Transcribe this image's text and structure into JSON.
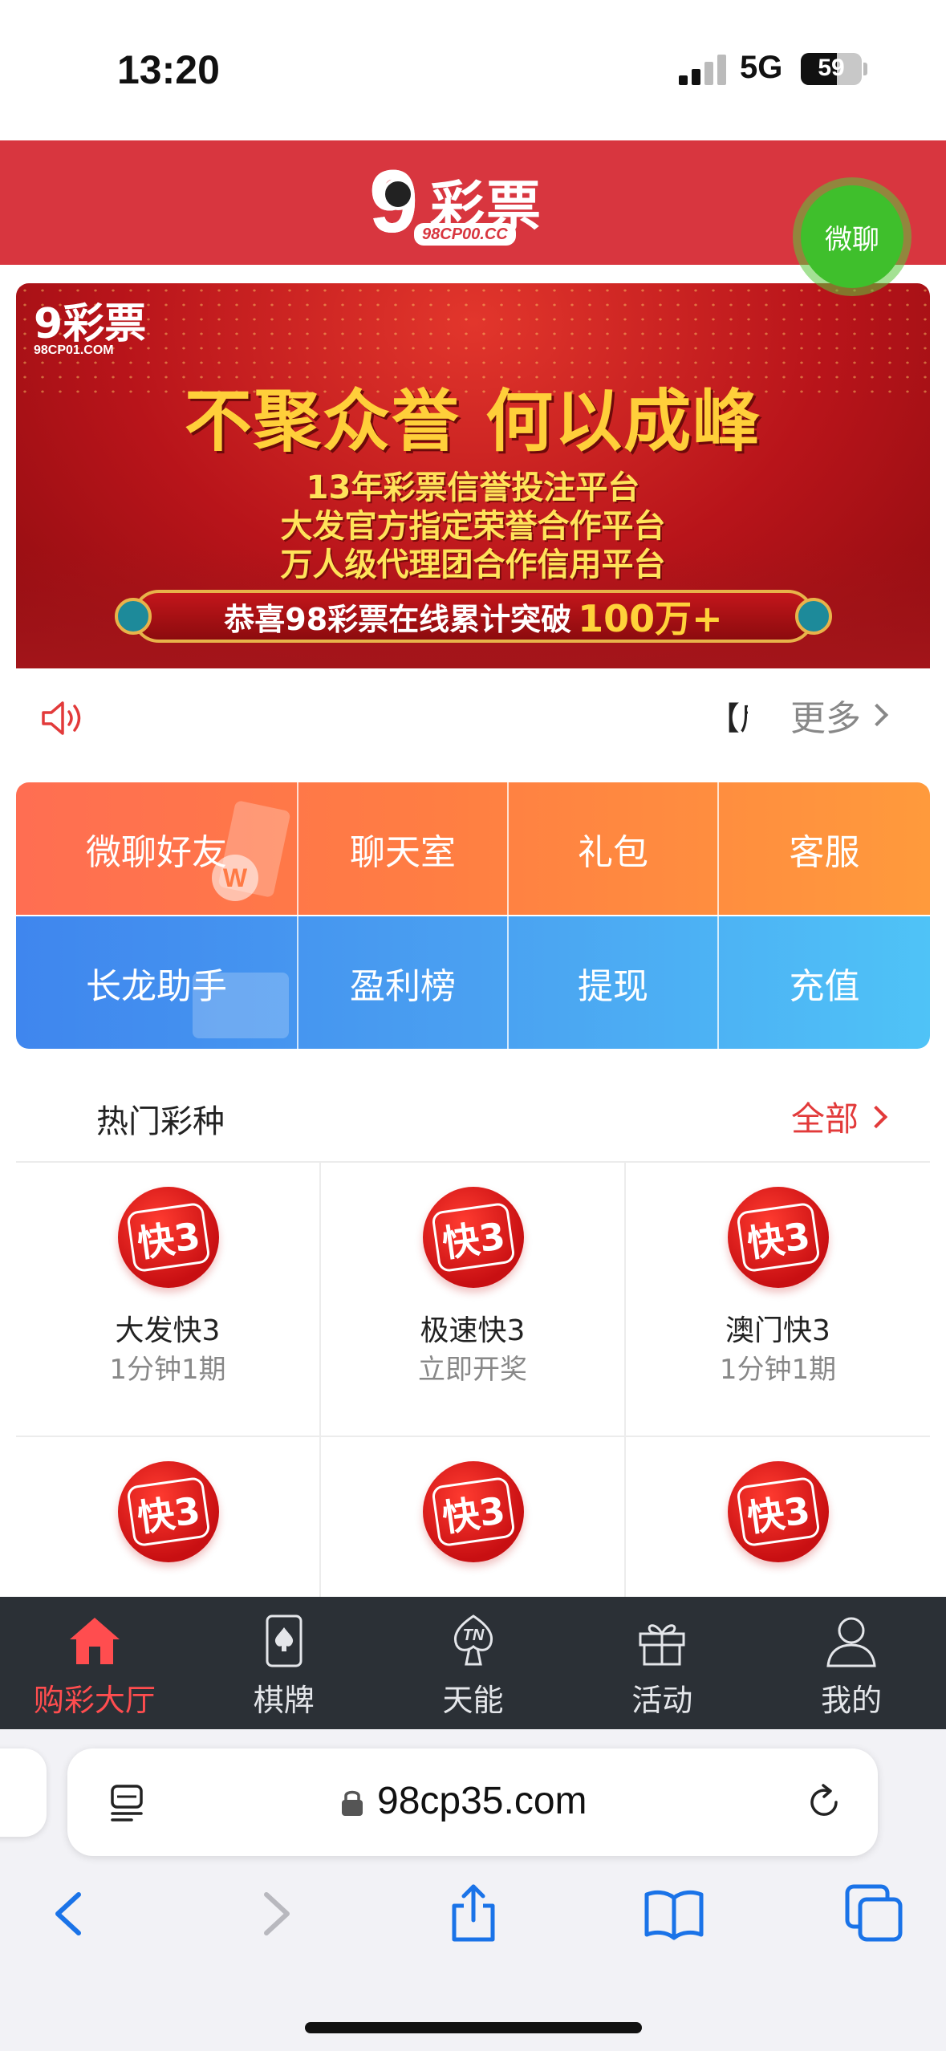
{
  "status": {
    "time": "13:20",
    "network": "5G",
    "battery": "59",
    "battery_level": 0.59
  },
  "header": {
    "logo_text": "彩票",
    "logo_url": "98CP00.CC",
    "chat_button": "微聊"
  },
  "banner": {
    "logo_text": "彩票",
    "logo_url": "98CP01.COM",
    "headline": "不聚众誉 何以成峰",
    "lines": [
      "13年彩票信誉投注平台",
      "大发官方指定荣誉合作平台",
      "万人级代理团合作信用平台"
    ],
    "ribbon_text": "恭喜98彩票在线累计突破",
    "ribbon_highlight": "100万+"
  },
  "notice": {
    "marquee": "【后",
    "more": "更多"
  },
  "quick_menu": {
    "top": [
      "微聊好友",
      "聊天室",
      "礼包",
      "客服"
    ],
    "bottom": [
      "长龙助手",
      "盈利榜",
      "提现",
      "充值"
    ]
  },
  "hot": {
    "title": "热门彩种",
    "all": "全部",
    "icon_text": "快3",
    "items": [
      {
        "name": "大发快3",
        "sub": "1分钟1期"
      },
      {
        "name": "极速快3",
        "sub": "立即开奖"
      },
      {
        "name": "澳门快3",
        "sub": "1分钟1期"
      },
      {
        "name": "",
        "sub": ""
      },
      {
        "name": "",
        "sub": ""
      },
      {
        "name": "",
        "sub": ""
      }
    ]
  },
  "tabbar": [
    {
      "label": "购彩大厅",
      "icon": "home-icon",
      "active": true
    },
    {
      "label": "棋牌",
      "icon": "poker-card-icon",
      "active": false
    },
    {
      "label": "天能",
      "icon": "tn-logo-icon",
      "active": false
    },
    {
      "label": "活动",
      "icon": "gift-icon",
      "active": false
    },
    {
      "label": "我的",
      "icon": "user-icon",
      "active": false
    }
  ],
  "browser": {
    "url": "98cp35.com"
  },
  "colors": {
    "header_red": "#d8363f",
    "active_tab": "#ff4d4f",
    "tab_bar": "#2b3036",
    "chat_green": "#3fbf2c"
  }
}
